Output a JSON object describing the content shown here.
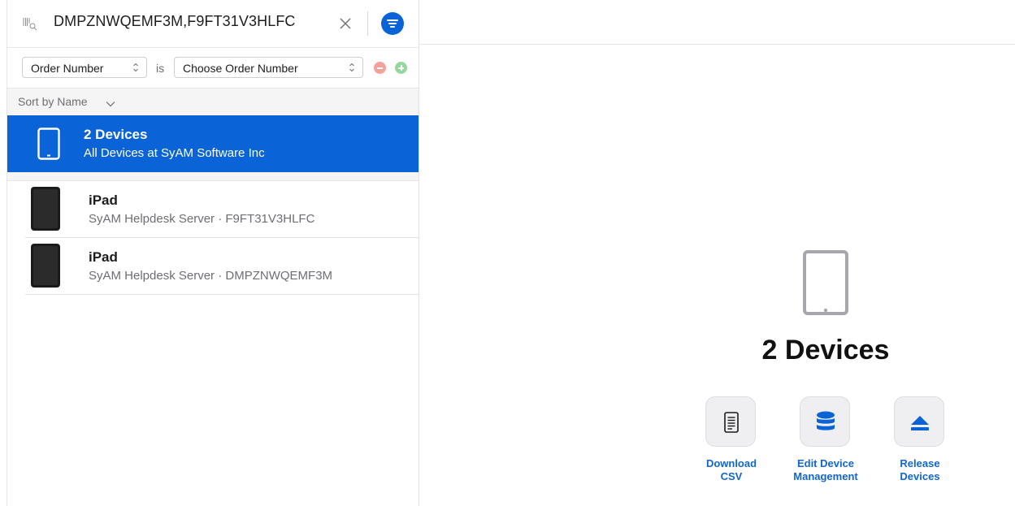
{
  "search": {
    "value": "DMPZNWQEMF3M,F9FT31V3HLFC"
  },
  "filter": {
    "field": "Order Number",
    "operator": "is",
    "value_placeholder": "Choose Order Number"
  },
  "sort": {
    "label": "Sort by Name"
  },
  "summary": {
    "title": "2 Devices",
    "subtitle": "All Devices at SyAM Software Inc"
  },
  "devices": [
    {
      "name": "iPad",
      "detail": "SyAM Helpdesk Server · F9FT31V3HLFC"
    },
    {
      "name": "iPad",
      "detail": "SyAM Helpdesk Server · DMPZNWQEMF3M"
    }
  ],
  "detail": {
    "title": "2 Devices",
    "actions": [
      {
        "line1": "Download",
        "line2": "CSV",
        "icon": "document-icon"
      },
      {
        "line1": "Edit Device",
        "line2": "Management",
        "icon": "database-icon"
      },
      {
        "line1": "Release",
        "line2": "Devices",
        "icon": "eject-icon"
      }
    ]
  },
  "colors": {
    "accent": "#0a64d8",
    "action_text": "#1166cc",
    "remove_button": "#f3a19a",
    "add_button": "#95d89e"
  }
}
